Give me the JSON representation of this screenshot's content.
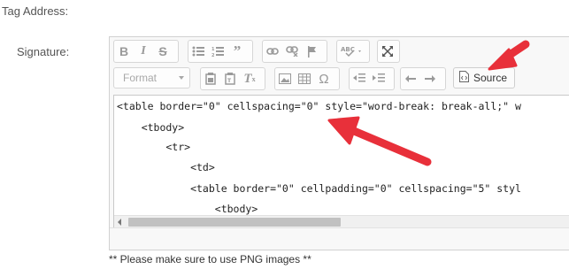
{
  "form": {
    "tag_address_label": "Tag Address:",
    "signature_label": "Signature:",
    "help_text": "** Please make sure to use PNG images **"
  },
  "toolbar": {
    "format_placeholder": "Format",
    "source_label": "Source",
    "row1_buttons": [
      "bold-icon",
      "italic-icon",
      "strikethrough-icon",
      "bulleted-list-icon",
      "numbered-list-icon",
      "blockquote-icon",
      "link-icon",
      "unlink-icon",
      "anchor-icon",
      "spellcheck-icon",
      "maximize-icon"
    ],
    "row2_buttons": [
      "paste-icon",
      "paste-text-icon",
      "remove-format-icon",
      "image-icon",
      "table-icon",
      "special-char-icon",
      "decrease-indent-icon",
      "increase-indent-icon",
      "undo-icon",
      "redo-icon",
      "source-icon"
    ]
  },
  "editor": {
    "code_lines": [
      "<table border=\"0\" cellspacing=\"0\" style=\"word-break: break-all;\" w",
      "    <tbody>",
      "        <tr>",
      "            <td>",
      "            <table border=\"0\" cellpadding=\"0\" cellspacing=\"5\" styl",
      "                <tbody>"
    ]
  },
  "annotations": {
    "arrow_color": "#e8303a"
  }
}
